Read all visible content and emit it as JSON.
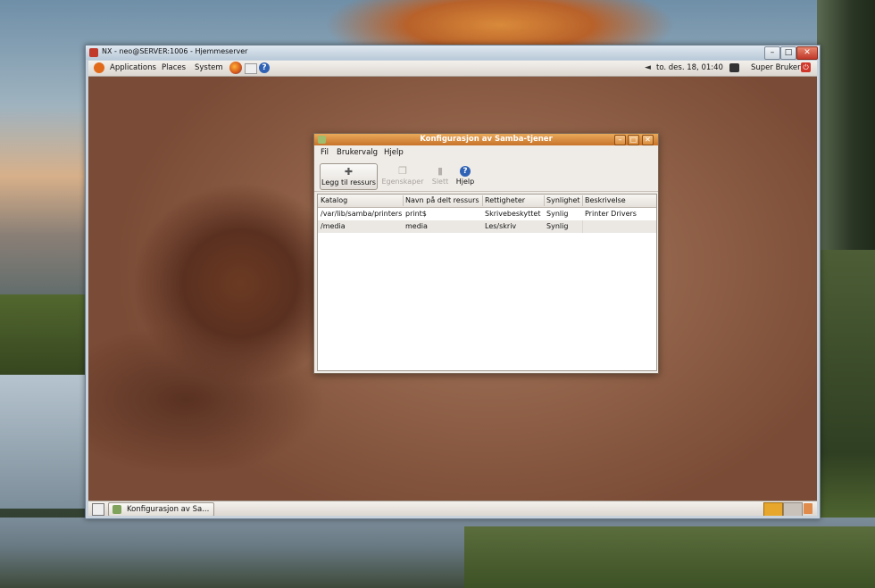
{
  "nx": {
    "title": "NX - neo@SERVER:1006 - Hjemmeserver"
  },
  "top_panel": {
    "menus": [
      "Applications",
      "Places",
      "System"
    ],
    "clock": "to. des. 18, 01:40",
    "user": "Super Bruker"
  },
  "bottom_panel": {
    "task_label": "Konfigurasjon av Sa..."
  },
  "dialog": {
    "title": "Konfigurasjon av Samba-tjener",
    "menus": [
      "Fil",
      "Brukervalg",
      "Hjelp"
    ],
    "toolbar": {
      "add": "Legg til ressurs",
      "properties": "Egenskaper",
      "delete": "Slett",
      "help": "Hjelp"
    },
    "table": {
      "headers": [
        "Katalog",
        "Navn på delt ressurs",
        "Rettigheter",
        "Synlighet",
        "Beskrivelse"
      ],
      "rows": [
        [
          "/var/lib/samba/printers",
          "print$",
          "Skrivebeskyttet",
          "Synlig",
          "Printer Drivers"
        ],
        [
          "/media",
          "media",
          "Les/skriv",
          "Synlig",
          ""
        ]
      ]
    }
  },
  "colors": {
    "dialog_titlebar": "#c8742a",
    "gnome_panel": "#dcd6cf",
    "desktop_brown": "#8d5e45"
  },
  "icons": [
    "ubuntu-logo-icon",
    "firefox-icon",
    "mail-icon",
    "help-icon",
    "speaker-icon",
    "monitor-icon",
    "logout-icon",
    "trash-icon"
  ]
}
